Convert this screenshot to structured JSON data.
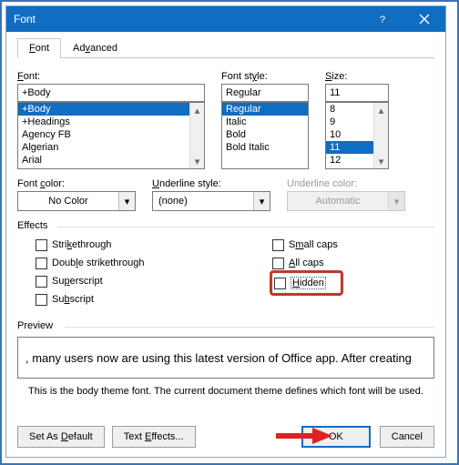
{
  "title": "Font",
  "tabs": {
    "font": "Font",
    "advanced": "Advanced"
  },
  "fontSection": {
    "fontLabel": "Font:",
    "styleLabel": "Font style:",
    "sizeLabel": "Size:",
    "fontValue": "+Body",
    "styleValue": "Regular",
    "sizeValue": "11",
    "fontList": [
      "+Body",
      "+Headings",
      "Agency FB",
      "Algerian",
      "Arial"
    ],
    "styleList": [
      "Regular",
      "Italic",
      "Bold",
      "Bold Italic"
    ],
    "sizeList": [
      "8",
      "9",
      "10",
      "11",
      "12"
    ],
    "fontSelectedIndex": 0,
    "styleSelectedIndex": 0,
    "sizeSelectedIndex": 3
  },
  "colorRow": {
    "fontColorLabel": "Font color:",
    "fontColorValue": "No Color",
    "underlineStyleLabel": "Underline style:",
    "underlineStyleValue": "(none)",
    "underlineColorLabel": "Underline color:",
    "underlineColorValue": "Automatic"
  },
  "effects": {
    "header": "Effects",
    "strike": "Strikethrough",
    "dstrike": "Double strikethrough",
    "superscript": "Superscript",
    "subscript": "Subscript",
    "smallcaps": "Small caps",
    "allcaps": "All caps",
    "hidden": "Hidden"
  },
  "preview": {
    "header": "Preview",
    "text": ", many users now are using this latest version of Office app. After creating",
    "note": "This is the body theme font. The current document theme defines which font will be used."
  },
  "buttons": {
    "setDefault": "Set As Default",
    "textEffects": "Text Effects...",
    "ok": "OK",
    "cancel": "Cancel"
  }
}
